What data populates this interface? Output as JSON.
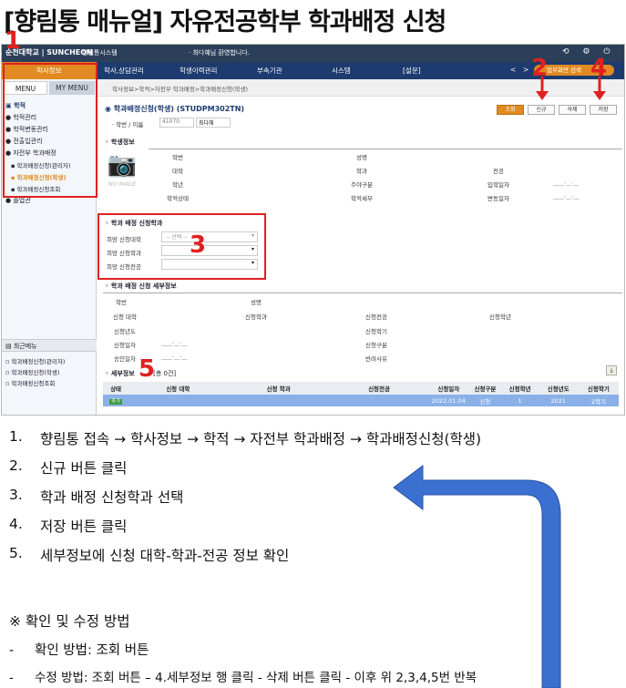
{
  "title": "[향림통 매뉴얼] 자유전공학부 학과배정 신청",
  "app": {
    "logo": "순천대학교 | SUNCHEON",
    "system_name": "향림통시스템",
    "welcome": "· 최다혜님 환영합니다.",
    "top_icons": "⟲ ⚙ ⏻"
  },
  "menubar": {
    "items": [
      "학사정보",
      "학사,상담관리",
      "학생이력관리",
      "부속기관",
      "시스템",
      "[설문]"
    ],
    "nav_prev": "<",
    "nav_next": ">",
    "quick_search": "업무화면 검색"
  },
  "sidebar": {
    "tabs": [
      "MENU",
      "MY MENU"
    ],
    "tree": [
      "학적",
      "학적관리",
      "학적변동관리",
      "전출입관리",
      "자전부 학과배정",
      "학과배정신청(관리자)",
      "학과배정신청(학생)",
      "학과배정신청조회",
      "졸업관"
    ],
    "recent_title": "최근메뉴",
    "recent_items": [
      "학과배정신청(관리자)",
      "학과배정신청(학생)",
      "학과배정신청조회"
    ]
  },
  "content": {
    "breadcrumb": "학사정보>학적>자전부 학과배정>학과배정신청(학생)",
    "page_title": "학과배정신청(학생) (STUDPM302TN)",
    "buttons": {
      "search": "조회",
      "new": "신규",
      "delete": "삭제",
      "save": "저장"
    },
    "filter_label": "· 학번 / 이름",
    "filter_id": "41070",
    "filter_name": "최다혜",
    "student_section": "학생정보",
    "no_image": "NO IMAGE",
    "student_labels": [
      "학번",
      "성명",
      "대학",
      "학과",
      "전공",
      "학년",
      "주야구분",
      "입학일자",
      "학적상태",
      "학적세부",
      "변동일자"
    ],
    "date_placeholder": "____-__-__",
    "apply_section": "학과 배정 신청학과",
    "apply_labels": [
      "희망 신청대학",
      "희망 신청학과",
      "희망 신청전공"
    ],
    "apply_select_placeholder": "-- 선택 --",
    "detail_section": "학과 배정 신청 세부정보",
    "detail_labels": [
      "학번",
      "성명",
      "신청 대학",
      "신청학과",
      "신청전공",
      "신청학년",
      "신청년도",
      "신청학기",
      "신청일자",
      "신청구분",
      "승인일자",
      "반려사유"
    ],
    "list_section": "세부정보",
    "list_count": "[총 0건]",
    "table_headers": [
      "상태",
      "신청 대학",
      "신청 학과",
      "신청전공",
      "신청일자",
      "신청구분",
      "신청학년",
      "신청년도",
      "신청학기"
    ],
    "table_row": [
      "추가",
      "",
      "",
      "",
      "2022.01.04",
      "신청",
      "1",
      "2021",
      "2학기"
    ]
  },
  "markers": [
    "1",
    "2",
    "3",
    "4",
    "5"
  ],
  "steps": [
    {
      "n": "1.",
      "text": "향림통 접속 → 학사정보 → 학적 → 자전부 학과배정 → 학과배정신청(학생)"
    },
    {
      "n": "2.",
      "text": "신규 버튼 클릭"
    },
    {
      "n": "3.",
      "text": "학과 배정 신청학과 선택"
    },
    {
      "n": "4.",
      "text": "저장 버튼 클릭"
    },
    {
      "n": "5.",
      "text": "세부정보에 신청 대학-학과-전공 정보 확인"
    }
  ],
  "notes": {
    "heading": "※ 확인 및 수정 방법",
    "items": [
      {
        "bullet": "-",
        "text": "확인 방법: 조회 버튼"
      },
      {
        "bullet": "-",
        "text": "수정 방법: 조회 버튼 – 4.세부정보 행 클릭 - 삭제 버튼 클릭 - 이후 위 2,3,4,5번 반복"
      }
    ]
  },
  "colors": {
    "accent": "#e08a21",
    "marker": "#e02020",
    "arrow": "#3b6fd0",
    "navy": "#1d3b6e"
  }
}
